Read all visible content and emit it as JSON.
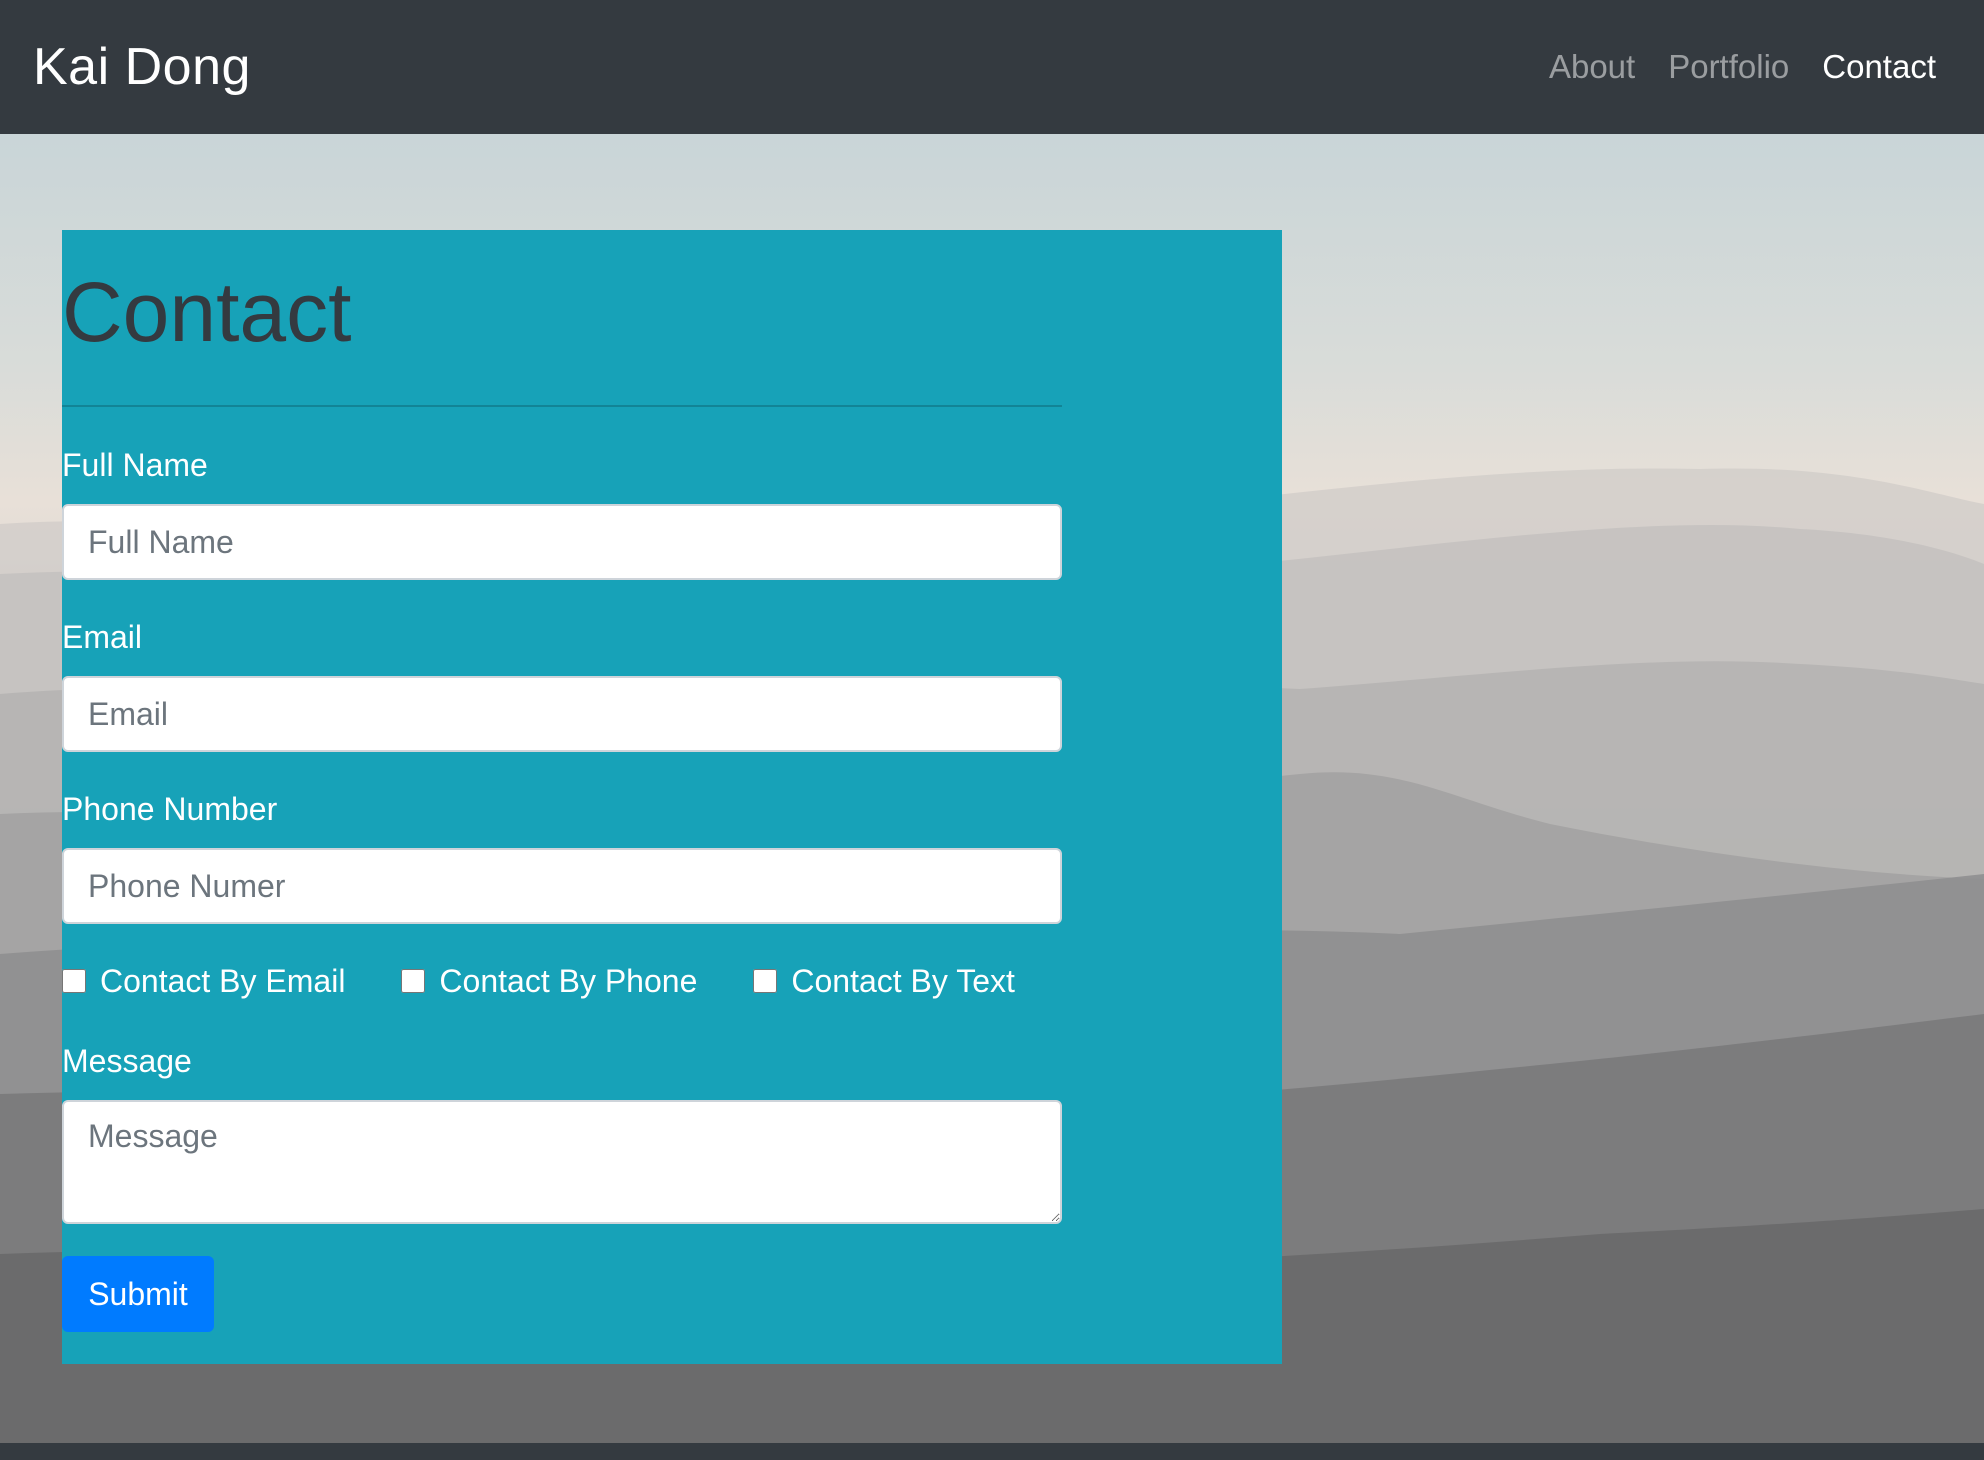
{
  "nav": {
    "brand": "Kai Dong",
    "links": [
      {
        "label": "About",
        "active": false
      },
      {
        "label": "Portfolio",
        "active": false
      },
      {
        "label": "Contact",
        "active": true
      }
    ]
  },
  "contact": {
    "title": "Contact",
    "fields": {
      "full_name": {
        "label": "Full Name",
        "placeholder": "Full Name",
        "value": ""
      },
      "email": {
        "label": "Email",
        "placeholder": "Email",
        "value": ""
      },
      "phone": {
        "label": "Phone Number",
        "placeholder": "Phone Numer",
        "value": ""
      },
      "message": {
        "label": "Message",
        "placeholder": "Message",
        "value": ""
      }
    },
    "checkboxes": [
      {
        "label": "Contact By Email",
        "checked": false
      },
      {
        "label": "Contact By Phone",
        "checked": false
      },
      {
        "label": "Contact By Text",
        "checked": false
      }
    ],
    "submit_label": "Submit"
  },
  "colors": {
    "navbar_bg": "#343a40",
    "card_bg": "#17a2b8",
    "heading": "#343a40",
    "submit_bg": "#007bff"
  }
}
